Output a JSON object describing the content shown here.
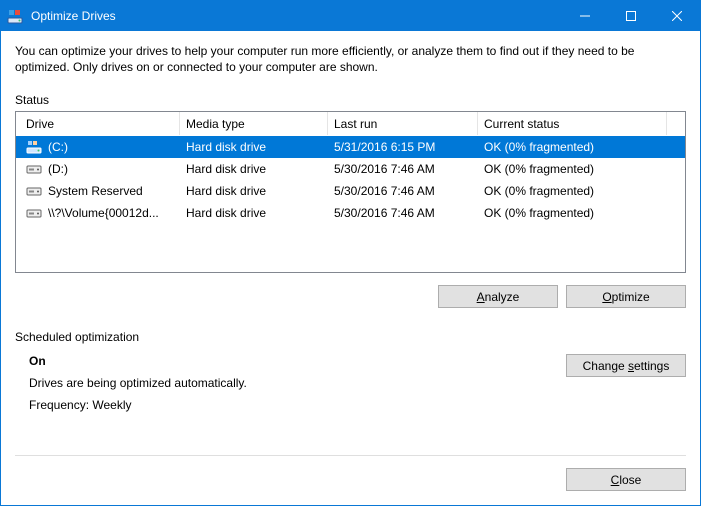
{
  "window": {
    "title": "Optimize Drives"
  },
  "intro": "You can optimize your drives to help your computer run more efficiently, or analyze them to find out if they need to be optimized. Only drives on or connected to your computer are shown.",
  "status_label": "Status",
  "columns": {
    "drive": "Drive",
    "media": "Media type",
    "last": "Last run",
    "status": "Current status"
  },
  "drives": [
    {
      "name": "(C:)",
      "icon": "os-drive",
      "media": "Hard disk drive",
      "last": "5/31/2016 6:15 PM",
      "status": "OK (0% fragmented)",
      "selected": true
    },
    {
      "name": "(D:)",
      "icon": "hdd",
      "media": "Hard disk drive",
      "last": "5/30/2016 7:46 AM",
      "status": "OK (0% fragmented)",
      "selected": false
    },
    {
      "name": "System Reserved",
      "icon": "hdd",
      "media": "Hard disk drive",
      "last": "5/30/2016 7:46 AM",
      "status": "OK (0% fragmented)",
      "selected": false
    },
    {
      "name": "\\\\?\\Volume{00012d...",
      "icon": "hdd",
      "media": "Hard disk drive",
      "last": "5/30/2016 7:46 AM",
      "status": "OK (0% fragmented)",
      "selected": false
    }
  ],
  "buttons": {
    "analyze_pre": "",
    "analyze_u": "A",
    "analyze_post": "nalyze",
    "optimize_pre": "",
    "optimize_u": "O",
    "optimize_post": "ptimize",
    "change_pre": "Change ",
    "change_u": "s",
    "change_post": "ettings",
    "close_pre": "",
    "close_u": "C",
    "close_post": "lose"
  },
  "scheduled": {
    "label": "Scheduled optimization",
    "on": "On",
    "desc": "Drives are being optimized automatically.",
    "freq": "Frequency: Weekly"
  }
}
